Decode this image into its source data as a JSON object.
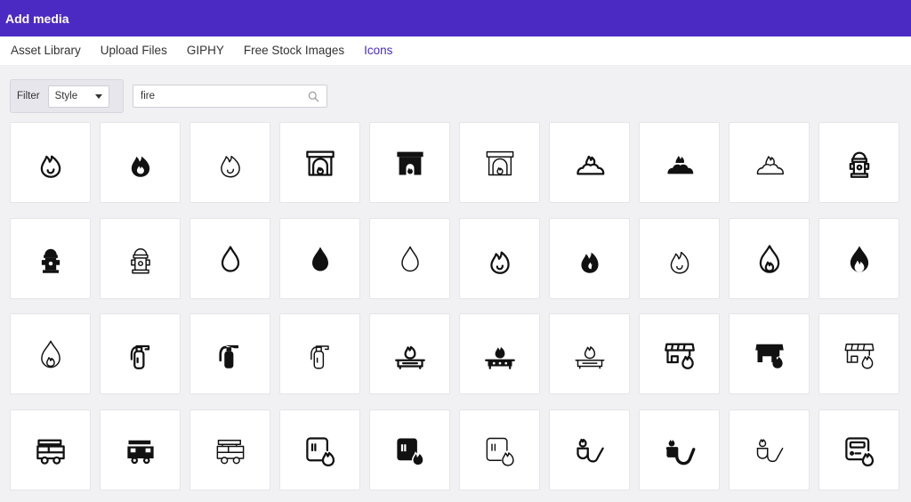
{
  "dialog": {
    "title": "Add media"
  },
  "tabs": [
    {
      "label": "Asset Library",
      "active": false
    },
    {
      "label": "Upload Files",
      "active": false
    },
    {
      "label": "GIPHY",
      "active": false
    },
    {
      "label": "Free Stock Images",
      "active": false
    },
    {
      "label": "Icons",
      "active": true
    }
  ],
  "filter": {
    "label": "Filter",
    "style_value": "Style"
  },
  "search": {
    "value": "fire",
    "placeholder": ""
  },
  "colors": {
    "header": "#4b2ac3",
    "active_tab": "#4b2ac3",
    "background": "#f1f1f4"
  },
  "icons": [
    {
      "name": "fire-outline-icon"
    },
    {
      "name": "fire-solid-icon"
    },
    {
      "name": "fire-thin-icon"
    },
    {
      "name": "fireplace-outline-icon"
    },
    {
      "name": "fireplace-solid-icon"
    },
    {
      "name": "fireplace-thin-icon"
    },
    {
      "name": "campfire-outline-icon"
    },
    {
      "name": "campfire-solid-icon"
    },
    {
      "name": "campfire-thin-icon"
    },
    {
      "name": "fire-hydrant-outline-icon"
    },
    {
      "name": "fire-hydrant-solid-icon"
    },
    {
      "name": "fire-hydrant-thin-icon"
    },
    {
      "name": "drop-outline-icon"
    },
    {
      "name": "drop-solid-icon"
    },
    {
      "name": "drop-thin-icon"
    },
    {
      "name": "flame-outline-icon"
    },
    {
      "name": "flame-solid-icon"
    },
    {
      "name": "flame-thin-icon"
    },
    {
      "name": "drop-flame-outline-icon"
    },
    {
      "name": "drop-flame-solid-icon"
    },
    {
      "name": "drop-flame-thin-icon"
    },
    {
      "name": "fire-extinguisher-outline-icon"
    },
    {
      "name": "fire-extinguisher-solid-icon"
    },
    {
      "name": "fire-extinguisher-thin-icon"
    },
    {
      "name": "gas-stove-outline-icon"
    },
    {
      "name": "gas-stove-solid-icon"
    },
    {
      "name": "gas-stove-thin-icon"
    },
    {
      "name": "store-fire-outline-icon"
    },
    {
      "name": "store-fire-solid-icon"
    },
    {
      "name": "store-fire-thin-icon"
    },
    {
      "name": "fire-truck-outline-icon"
    },
    {
      "name": "fire-truck-solid-icon"
    },
    {
      "name": "fire-truck-thin-icon"
    },
    {
      "name": "card-fire-outline-icon"
    },
    {
      "name": "card-fire-solid-icon"
    },
    {
      "name": "card-fire-thin-icon"
    },
    {
      "name": "smoking-pipe-outline-icon"
    },
    {
      "name": "smoking-pipe-solid-icon"
    },
    {
      "name": "smoking-pipe-thin-icon"
    },
    {
      "name": "fire-device-outline-icon"
    }
  ]
}
